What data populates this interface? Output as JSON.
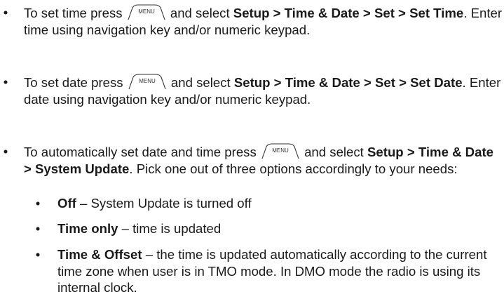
{
  "menu_key": {
    "label": "MENU"
  },
  "items": [
    {
      "bullet": "•",
      "t1": "To set time press ",
      "t2": " and select ",
      "b1": "Setup > Time & Date > Set > Set Time",
      "t3": ". Enter time using navigation key and/or numeric keypad."
    },
    {
      "bullet": "•",
      "t1": "To set date press ",
      "t2": " and select ",
      "b1": "Setup > Time & Date > Set > Set Date",
      "t3": ". Enter date using navigation key and/or numeric keypad."
    },
    {
      "bullet": "•",
      "t1": "To automatically set date and time press ",
      "t2": " and select ",
      "b1": "Setup > Time & Date > System Update",
      "t3": ". Pick one out of three options accordingly to your needs:"
    }
  ],
  "subitems": [
    {
      "bullet": "•",
      "term": "Off",
      "desc": " – System Update is turned off"
    },
    {
      "bullet": "•",
      "term": "Time only",
      "desc": " – time is updated"
    },
    {
      "bullet": "•",
      "term": "Time & Offset",
      "desc": " – the time is updated automatically according to the current time zone when user is in TMO mode. In DMO mode the radio is using its internal clock."
    }
  ]
}
